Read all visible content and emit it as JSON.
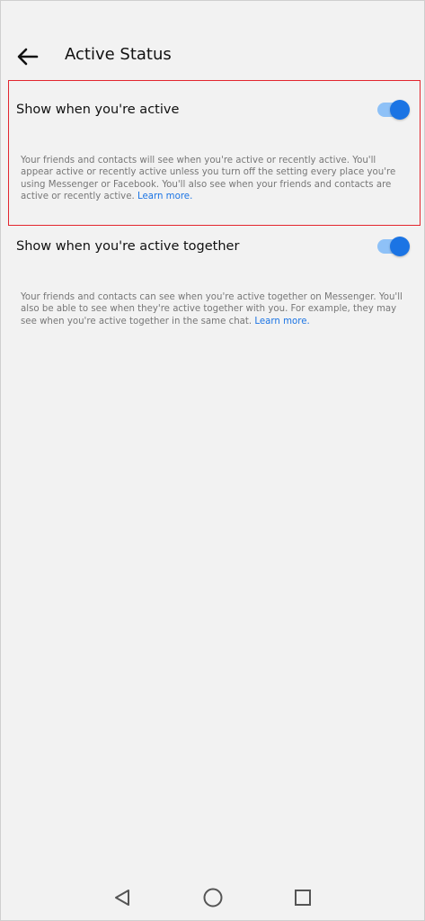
{
  "header": {
    "title": "Active Status",
    "back_icon": "arrow-left-icon"
  },
  "settings": [
    {
      "label": "Show when you're active",
      "enabled": true,
      "description": "Your friends and contacts will see when you're active or recently active. You'll appear active or recently active unless you turn off the setting every place you're using Messenger or Facebook. You'll also see when your friends and contacts are active or recently active.",
      "link": "Learn more."
    },
    {
      "label": "Show when you're active together",
      "enabled": true,
      "description": "Your friends and contacts can see when you're active together on Messenger. You'll also be able to see when they're active together with you. For example, they may see when you're active together in the same chat.",
      "link": "Learn more."
    }
  ],
  "colors": {
    "accent": "#1b74e4",
    "track": "#8ec1f7",
    "highlight": "#e3262e",
    "background": "#f2f2f2"
  },
  "navbar": {
    "icons": [
      "back-triangle-icon",
      "home-circle-icon",
      "recents-square-icon"
    ]
  }
}
